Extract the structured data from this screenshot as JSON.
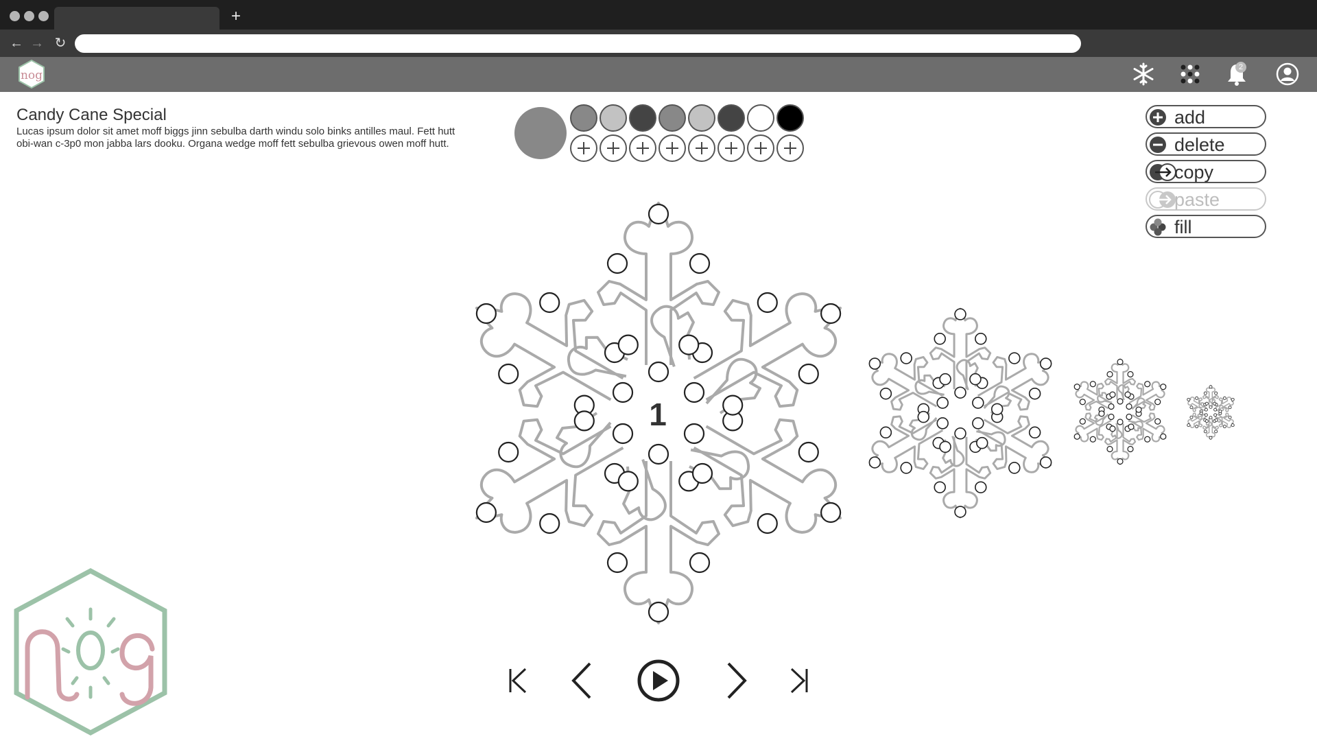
{
  "browser": {
    "tab_title": "",
    "new_tab_label": "+",
    "back_label": "←",
    "forward_label": "→",
    "reload_label": "↻",
    "url": ""
  },
  "app_header": {
    "notification_count": "2",
    "icons": [
      "snowflake-icon",
      "dots-grid-icon",
      "bell-icon",
      "user-icon"
    ]
  },
  "design": {
    "title": "Candy Cane Special",
    "description": "Lucas ipsum dolor sit amet moff biggs jinn sebulba darth windu solo binks antilles maul. Fett hutt obi-wan c-3p0 mon jabba lars dooku. Organa wedge moff fett sebulba grievous owen moff hutt."
  },
  "palette": {
    "current_color": "#888888",
    "swatches": [
      "#888888",
      "#c2c2c2",
      "#444444",
      "#888888",
      "#c2c2c2",
      "#444444",
      "#ffffff",
      "#000000"
    ]
  },
  "actions": [
    {
      "key": "add",
      "label": "add",
      "icon": "plus-circle-icon",
      "enabled": true
    },
    {
      "key": "delete",
      "label": "delete",
      "icon": "minus-circle-icon",
      "enabled": true
    },
    {
      "key": "copy",
      "label": "copy",
      "icon": "copy-icon",
      "enabled": true
    },
    {
      "key": "paste",
      "label": "paste",
      "icon": "paste-icon",
      "enabled": false
    },
    {
      "key": "fill",
      "label": "fill",
      "icon": "fill-icon",
      "enabled": true
    }
  ],
  "frame": {
    "number": "1"
  },
  "playback": {
    "buttons": [
      "first-frame-icon",
      "previous-frame-icon",
      "play-icon",
      "next-frame-icon",
      "last-frame-icon"
    ]
  },
  "logo_text": "nog",
  "colors": {
    "chrome_dark": "#1f1f1f",
    "chrome_mid": "#3a3a3a",
    "app_bar": "#6d6d6d",
    "outline": "#aaaaaa",
    "logo_hex": "#9cc2a8",
    "logo_letters": "#d2a2aa"
  }
}
